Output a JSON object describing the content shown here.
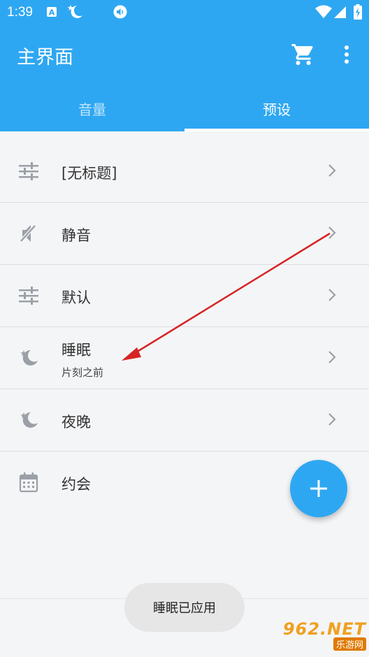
{
  "status_bar": {
    "time": "1:39",
    "icons": [
      "accessibility-a-icon",
      "moon-star-icon",
      "volume-icon",
      "wifi-icon",
      "signal-icon",
      "battery-charging-icon"
    ]
  },
  "app_bar": {
    "title": "主界面",
    "actions": [
      "cart-icon",
      "more-vert-icon"
    ]
  },
  "tabs": [
    {
      "label": "音量",
      "selected": false
    },
    {
      "label": "预设",
      "selected": true
    }
  ],
  "presets": [
    {
      "label": "[无标题]",
      "subtitle": "",
      "icon": "sliders-icon"
    },
    {
      "label": "静音",
      "subtitle": "",
      "icon": "volume-mute-icon"
    },
    {
      "label": "默认",
      "subtitle": "",
      "icon": "sliders-icon"
    },
    {
      "label": "睡眠",
      "subtitle": "片刻之前",
      "icon": "moon-star-icon"
    },
    {
      "label": "夜晚",
      "subtitle": "",
      "icon": "moon-star-icon"
    },
    {
      "label": "约会",
      "subtitle": "",
      "icon": "calendar-icon"
    }
  ],
  "fab": {
    "icon": "plus-icon"
  },
  "toast": {
    "text": "睡眠已应用"
  },
  "watermark": {
    "main": "962.NET",
    "sub": "乐游网"
  },
  "colors": {
    "primary": "#2ea7f2",
    "annotation_arrow": "#d62424",
    "icon_grey": "#9aa0a6"
  }
}
